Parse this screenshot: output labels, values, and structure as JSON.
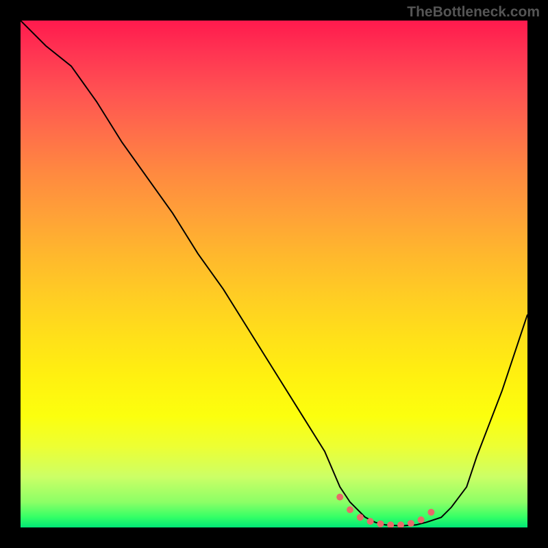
{
  "watermark": "TheBottleneck.com",
  "chart_data": {
    "type": "line",
    "title": "",
    "xlabel": "",
    "ylabel": "",
    "xlim": [
      0,
      100
    ],
    "ylim": [
      0,
      100
    ],
    "series": [
      {
        "name": "bottleneck-curve",
        "x": [
          0,
          5,
          10,
          15,
          20,
          25,
          30,
          35,
          40,
          45,
          50,
          55,
          60,
          63,
          65,
          68,
          70,
          72,
          75,
          78,
          80,
          83,
          85,
          88,
          90,
          95,
          100
        ],
        "y": [
          100,
          95,
          91,
          84,
          76,
          69,
          62,
          54,
          47,
          39,
          31,
          23,
          15,
          8,
          5,
          2,
          1,
          0.5,
          0.3,
          0.5,
          1,
          2,
          4,
          8,
          14,
          27,
          42
        ]
      }
    ],
    "markers": {
      "name": "emphasis-dots",
      "x": [
        63,
        65,
        67,
        69,
        71,
        73,
        75,
        77,
        79,
        81
      ],
      "y": [
        6,
        3.5,
        2,
        1.2,
        0.7,
        0.5,
        0.5,
        0.8,
        1.5,
        3
      ]
    },
    "background_gradient": {
      "stops": [
        {
          "pos": 0,
          "color": "#ff1a4d"
        },
        {
          "pos": 50,
          "color": "#ffcc24"
        },
        {
          "pos": 85,
          "color": "#fcff0e"
        },
        {
          "pos": 100,
          "color": "#00e676"
        }
      ]
    }
  }
}
